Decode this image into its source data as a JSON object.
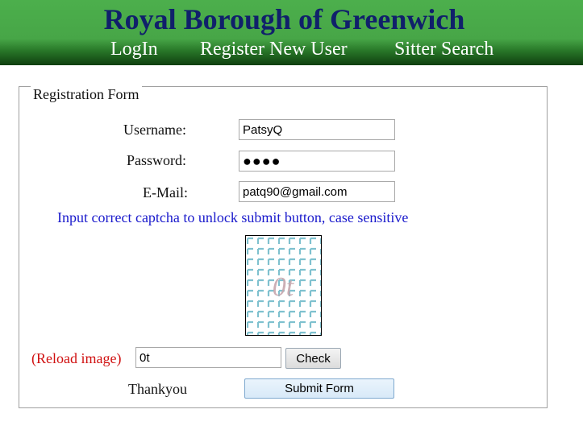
{
  "header": {
    "title": "Royal Borough of Greenwich",
    "nav": {
      "login": "LogIn",
      "register": "Register New User",
      "sitter_search": "Sitter Search"
    }
  },
  "form": {
    "legend": "Registration Form",
    "username_label": "Username:",
    "username_value": "PatsyQ",
    "password_label": "Password:",
    "password_mask": "●●●●",
    "email_label": "E-Mail:",
    "email_value": "patq90@gmail.com",
    "captcha_message": "Input correct captcha to unlock submit button, case sensitive",
    "captcha_text": "0t",
    "reload_label": "(Reload image)",
    "captcha_input_value": "0t",
    "check_label": "Check",
    "thankyou": "Thankyou",
    "submit_label": "Submit Form"
  },
  "colors": {
    "header_green": "#47a647",
    "title_navy": "#10206b",
    "captcha_msg_blue": "#1a1acc",
    "reload_red": "#d01010",
    "captcha_grid": "#7fc1cf"
  }
}
